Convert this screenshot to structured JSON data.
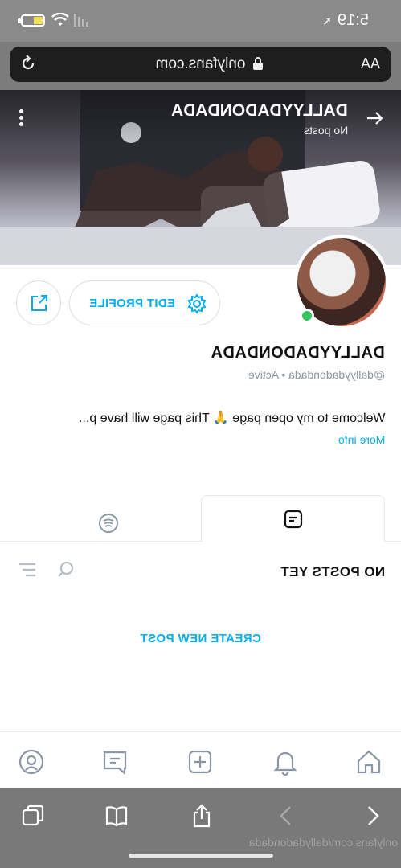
{
  "status_bar": {
    "time": "5:19",
    "location_arrow": "➚",
    "battery_level": 0.35
  },
  "browser": {
    "url": "onlyfans.com",
    "text_size_label": "AA"
  },
  "cover": {
    "name": "DALLYYDADONDADA",
    "subtitle": "No posts"
  },
  "profile": {
    "edit_label": "EDIT PROFILE",
    "name": "DALLYYDADONDADA",
    "handle": "@dallyydadondada",
    "status": "Active",
    "bio": "Welcome to my open page 🙏 This page will have p...",
    "more_info": "More info"
  },
  "tabs": {
    "active": "posts",
    "items": [
      "spotify",
      "posts"
    ]
  },
  "posts": {
    "filter_label": "NO POSTS YET",
    "create_label": "CREATE NEW POST"
  },
  "bottom_nav": [
    "home-icon",
    "bell-icon",
    "add-icon",
    "messages-icon",
    "profile-icon"
  ],
  "toolbar": {
    "footer_url": "onlyfans.com/dallydadondada"
  },
  "colors": {
    "accent": "#00aff0",
    "online": "#37c35f",
    "muted": "#8a96a3"
  }
}
